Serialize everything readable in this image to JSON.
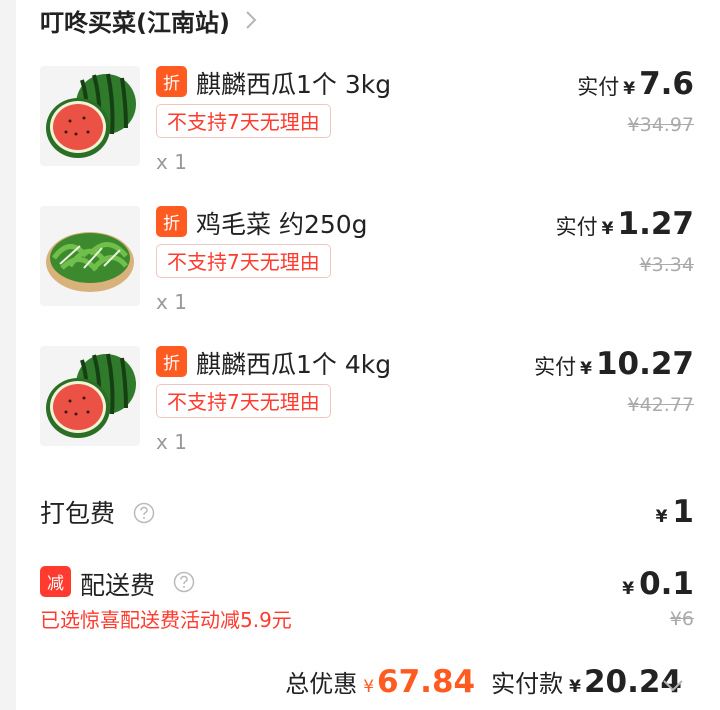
{
  "shop": {
    "name": "叮咚买菜(江南站)",
    "chevron_icon": "chevron-right-icon"
  },
  "colors": {
    "accent_orange": "#ff5a1f",
    "accent_red": "#ff3b2f",
    "muted": "#aaaaaa"
  },
  "items": [
    {
      "badge": "折",
      "name": "麒麟西瓜1个 3kg",
      "tag": "不支持7天无理由",
      "qty": "x 1",
      "paid_label": "实付",
      "currency": "¥",
      "paid": "7.6",
      "original": "¥34.97",
      "image": "watermelon-image"
    },
    {
      "badge": "折",
      "name": "鸡毛菜 约250g",
      "tag": "不支持7天无理由",
      "qty": "x 1",
      "paid_label": "实付",
      "currency": "¥",
      "paid": "1.27",
      "original": "¥3.34",
      "image": "greens-image"
    },
    {
      "badge": "折",
      "name": "麒麟西瓜1个 4kg",
      "tag": "不支持7天无理由",
      "qty": "x 1",
      "paid_label": "实付",
      "currency": "¥",
      "paid": "10.27",
      "original": "¥42.77",
      "image": "watermelon-image"
    }
  ],
  "packing_fee": {
    "label": "打包费",
    "currency": "¥",
    "amount": "1"
  },
  "delivery_fee": {
    "badge": "减",
    "label": "配送费",
    "currency": "¥",
    "amount": "0.1",
    "original": "¥6",
    "promo_note": "已选惊喜配送费活动减5.9元"
  },
  "summary": {
    "discount_label": "总优惠",
    "currency": "¥",
    "discount": "67.84",
    "paid_label": "实付款",
    "paid": "20.24",
    "chevron_icon": "chevron-down-icon"
  }
}
